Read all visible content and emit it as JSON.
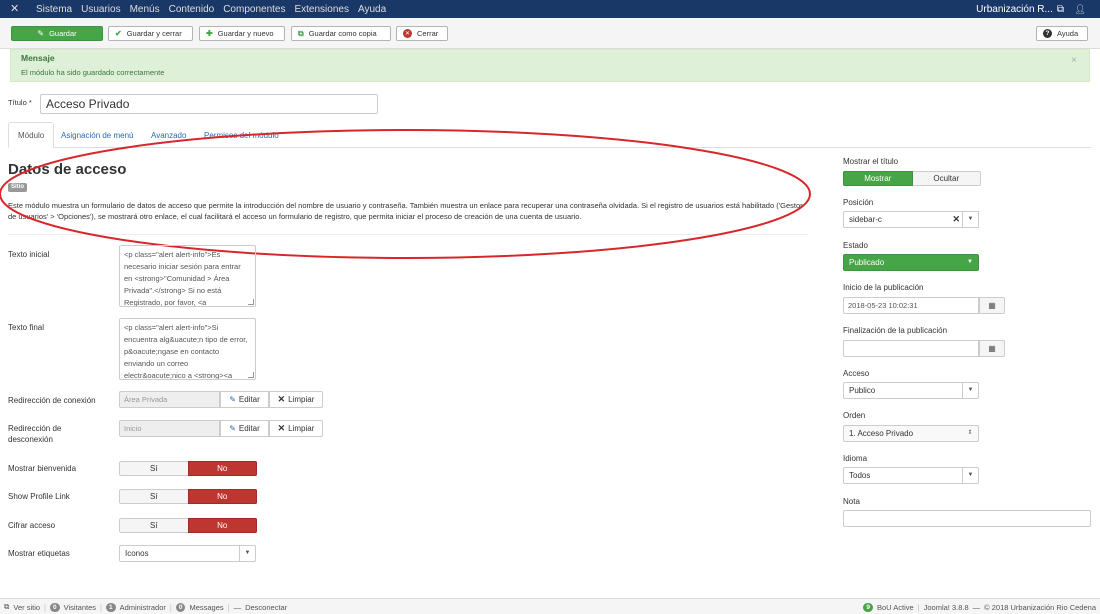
{
  "navbar": {
    "logo_icon": "joomla-logo-icon",
    "menu": [
      "Sistema",
      "Usuarios",
      "Menús",
      "Contenido",
      "Componentes",
      "Extensiones",
      "Ayuda"
    ],
    "site_name": "Urbanización R...",
    "user_icon": "user-icon"
  },
  "toolbar": {
    "save": "Guardar",
    "save_close": "Guardar y cerrar",
    "save_new": "Guardar y nuevo",
    "save_copy": "Guardar como copia",
    "close": "Cerrar",
    "help": "Ayuda"
  },
  "message": {
    "heading": "Mensaje",
    "text": "El módulo ha sido guardado correctamente",
    "close": "×"
  },
  "title": {
    "label": "Título *",
    "value": "Acceso Privado"
  },
  "tabs": [
    "Módulo",
    "Asignación de menú",
    "Avanzado",
    "Permisos del módulo"
  ],
  "module": {
    "name": "Datos de acceso",
    "badge": "Sitio",
    "description": "Este módulo muestra un formulario de datos de acceso que permite la introducción del nombre de usuario y contraseña. También muestra un enlace para recuperar una contraseña olvidada. Si el registro de usuarios está habilitado ('Gestor de usuarios' > 'Opciones'), se mostrará otro enlace, el cual facilitará el acceso un formulario de registro, que permita iniciar el proceso de creación de una cuenta de usuario."
  },
  "fields": {
    "pretext_label": "Texto inicial",
    "pretext_value": "<p class=\"alert alert-info\">Es necesario iniciar sesión para entrar en <strong>\"Comunidad > Área Privada\".</strong> Si no está Registrado, por favor, <a",
    "posttext_label": "Texto final",
    "posttext_value": "<p class=\"alert alert-info\">Si encuentra alg&uacute;n tipo de error, p&oacute;ngase en contacto enviando un correo electr&oacute;nico a <strong><a",
    "login_label": "Redirección de conexión",
    "login_value": "Área Privada",
    "logout_label": "Redirección de desconexión",
    "logout_value": "Inicio",
    "edit": "Editar",
    "clear": "Limpiar",
    "greeting_label": "Mostrar bienvenida",
    "profile_label": "Show Profile Link",
    "encrypt_label": "Cifrar acceso",
    "yes": "Sí",
    "no": "No",
    "labels_label": "Mostrar etiquetas",
    "labels_value": "Iconos"
  },
  "sidebar": {
    "showtitle_label": "Mostrar el título",
    "show": "Mostrar",
    "hide": "Ocultar",
    "position_label": "Posición",
    "position_value": "sidebar-c",
    "status_label": "Estado",
    "status_value": "Publicado",
    "publish_up_label": "Inicio de la publicación",
    "publish_up_value": "2018-05-23 10:02:31",
    "publish_down_label": "Finalización de la publicación",
    "publish_down_value": "",
    "access_label": "Acceso",
    "access_value": "Publico",
    "order_label": "Orden",
    "order_value": "1. Acceso Privado",
    "language_label": "Idioma",
    "language_value": "Todos",
    "note_label": "Nota",
    "note_value": ""
  },
  "footer": {
    "view_site": "Ver sitio",
    "visitors_count": "0",
    "visitors": "Visitantes",
    "admins_count": "1",
    "admins": "Administrador",
    "messages_count": "0",
    "messages": "Messages",
    "logout": "Desconectar",
    "bou_count": "9",
    "bou": "BoU Active",
    "version": "Joomla! 3.8.8",
    "copyright": "© 2018 Urbanización Rio Cedena"
  },
  "colors": {
    "navbar": "#1a3867",
    "success": "#46a546",
    "danger": "#bd362f",
    "annotation": "#d9262a"
  }
}
